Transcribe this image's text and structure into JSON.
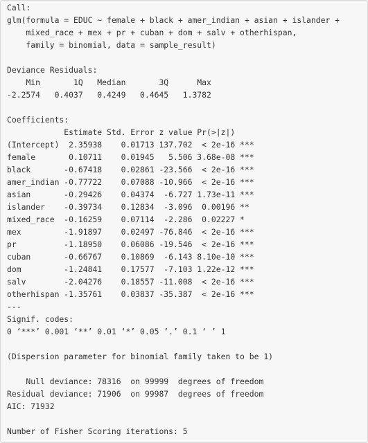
{
  "output": {
    "lines": [
      "Call:",
      "glm(formula = EDUC ~ female + black + amer_indian + asian + islander +",
      "    mixed_race + mex + pr + cuban + dom + salv + otherhispan,",
      "    family = binomial, data = sample_result)",
      "",
      "Deviance Residuals: ",
      "    Min       1Q   Median       3Q      Max  ",
      "-2.2574   0.4037   0.4249   0.4645   1.3782  ",
      "",
      "Coefficients:",
      "            Estimate Std. Error z value Pr(>|z|)    ",
      "(Intercept)  2.35938    0.01713 137.702  < 2e-16 ***",
      "female       0.10711    0.01945   5.506 3.68e-08 ***",
      "black       -0.67418    0.02861 -23.566  < 2e-16 ***",
      "amer_indian -0.77722    0.07088 -10.966  < 2e-16 ***",
      "asian       -0.29426    0.04374  -6.727 1.73e-11 ***",
      "islander    -0.39734    0.12834  -3.096  0.00196 ** ",
      "mixed_race  -0.16259    0.07114  -2.286  0.02227 *  ",
      "mex         -1.91897    0.02497 -76.846  < 2e-16 ***",
      "pr          -1.18950    0.06086 -19.546  < 2e-16 ***",
      "cuban       -0.66767    0.10869  -6.143 8.10e-10 ***",
      "dom         -1.24841    0.17577  -7.103 1.22e-12 ***",
      "salv        -2.04276    0.18557 -11.008  < 2e-16 ***",
      "otherhispan -1.35761    0.03837 -35.387  < 2e-16 ***",
      "---",
      "Signif. codes:  ",
      "0 ‘***’ 0.001 ‘**’ 0.01 ‘*’ 0.05 ‘.’ 0.1 ‘ ’ 1",
      "",
      "(Dispersion parameter for binomial family taken to be 1)",
      "",
      "    Null deviance: 78316  on 99999  degrees of freedom",
      "Residual deviance: 71906  on 99987  degrees of freedom",
      "AIC: 71932",
      "",
      "Number of Fisher Scoring iterations: 5"
    ]
  }
}
